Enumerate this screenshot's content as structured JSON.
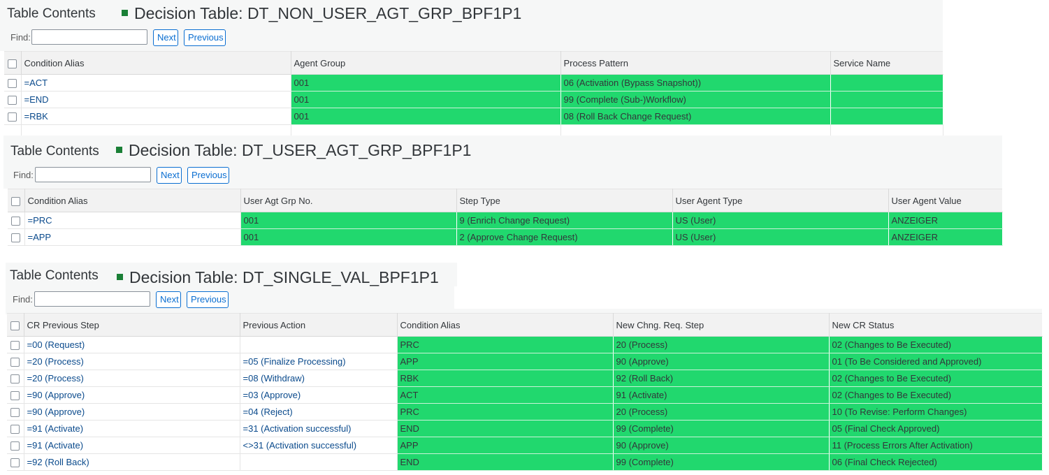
{
  "find_label": "Find:",
  "next_label": "Next",
  "previous_label": "Previous",
  "table_contents_label": "Table Contents",
  "accent_color": "#1a7f36",
  "highlight_color": "#21d86e",
  "t1": {
    "title": "Decision Table: DT_NON_USER_AGT_GRP_BPF1P1",
    "find_value": "",
    "columns": [
      "Condition Alias",
      "Agent Group",
      "Process Pattern",
      "Service Name"
    ],
    "rows": [
      [
        "=ACT",
        "001",
        "06 (Activation (Bypass Snapshot))",
        ""
      ],
      [
        "=END",
        "001",
        "99 (Complete (Sub-)Workflow)",
        ""
      ],
      [
        "=RBK",
        "001",
        "08 (Roll Back Change Request)",
        ""
      ]
    ]
  },
  "t2": {
    "title": "Decision Table: DT_USER_AGT_GRP_BPF1P1",
    "find_value": "",
    "columns": [
      "Condition Alias",
      "User Agt Grp No.",
      "Step Type",
      "User Agent Type",
      "User Agent Value"
    ],
    "rows": [
      [
        "=PRC",
        "001",
        "9 (Enrich Change Request)",
        "US (User)",
        "ANZEIGER"
      ],
      [
        "=APP",
        "001",
        "2 (Approve Change Request)",
        "US (User)",
        "ANZEIGER"
      ]
    ]
  },
  "t3": {
    "title": "Decision Table: DT_SINGLE_VAL_BPF1P1",
    "find_value": "",
    "columns": [
      "CR Previous Step",
      "Previous Action",
      "Condition Alias",
      "New Chng. Req. Step",
      "New CR Status"
    ],
    "rows": [
      [
        "=00 (Request)",
        "",
        "PRC",
        "20 (Process)",
        "02 (Changes to Be Executed)"
      ],
      [
        "=20 (Process)",
        "=05 (Finalize Processing)",
        "APP",
        "90 (Approve)",
        "01 (To Be Considered and Approved)"
      ],
      [
        "=20 (Process)",
        "=08 (Withdraw)",
        "RBK",
        "92 (Roll Back)",
        "02 (Changes to Be Executed)"
      ],
      [
        "=90 (Approve)",
        "=03 (Approve)",
        "ACT",
        "91 (Activate)",
        "02 (Changes to Be Executed)"
      ],
      [
        "=90 (Approve)",
        "=04 (Reject)",
        "PRC",
        "20 (Process)",
        "10 (To Revise: Perform Changes)"
      ],
      [
        "=91 (Activate)",
        "=31 (Activation successful)",
        "END",
        "99 (Complete)",
        "05 (Final Check Approved)"
      ],
      [
        "=91 (Activate)",
        "<>31 (Activation successful)",
        "APP",
        "90 (Approve)",
        "11 (Process Errors After Activation)"
      ],
      [
        "=92 (Roll Back)",
        "",
        "END",
        "99 (Complete)",
        "06 (Final Check Rejected)"
      ]
    ]
  }
}
